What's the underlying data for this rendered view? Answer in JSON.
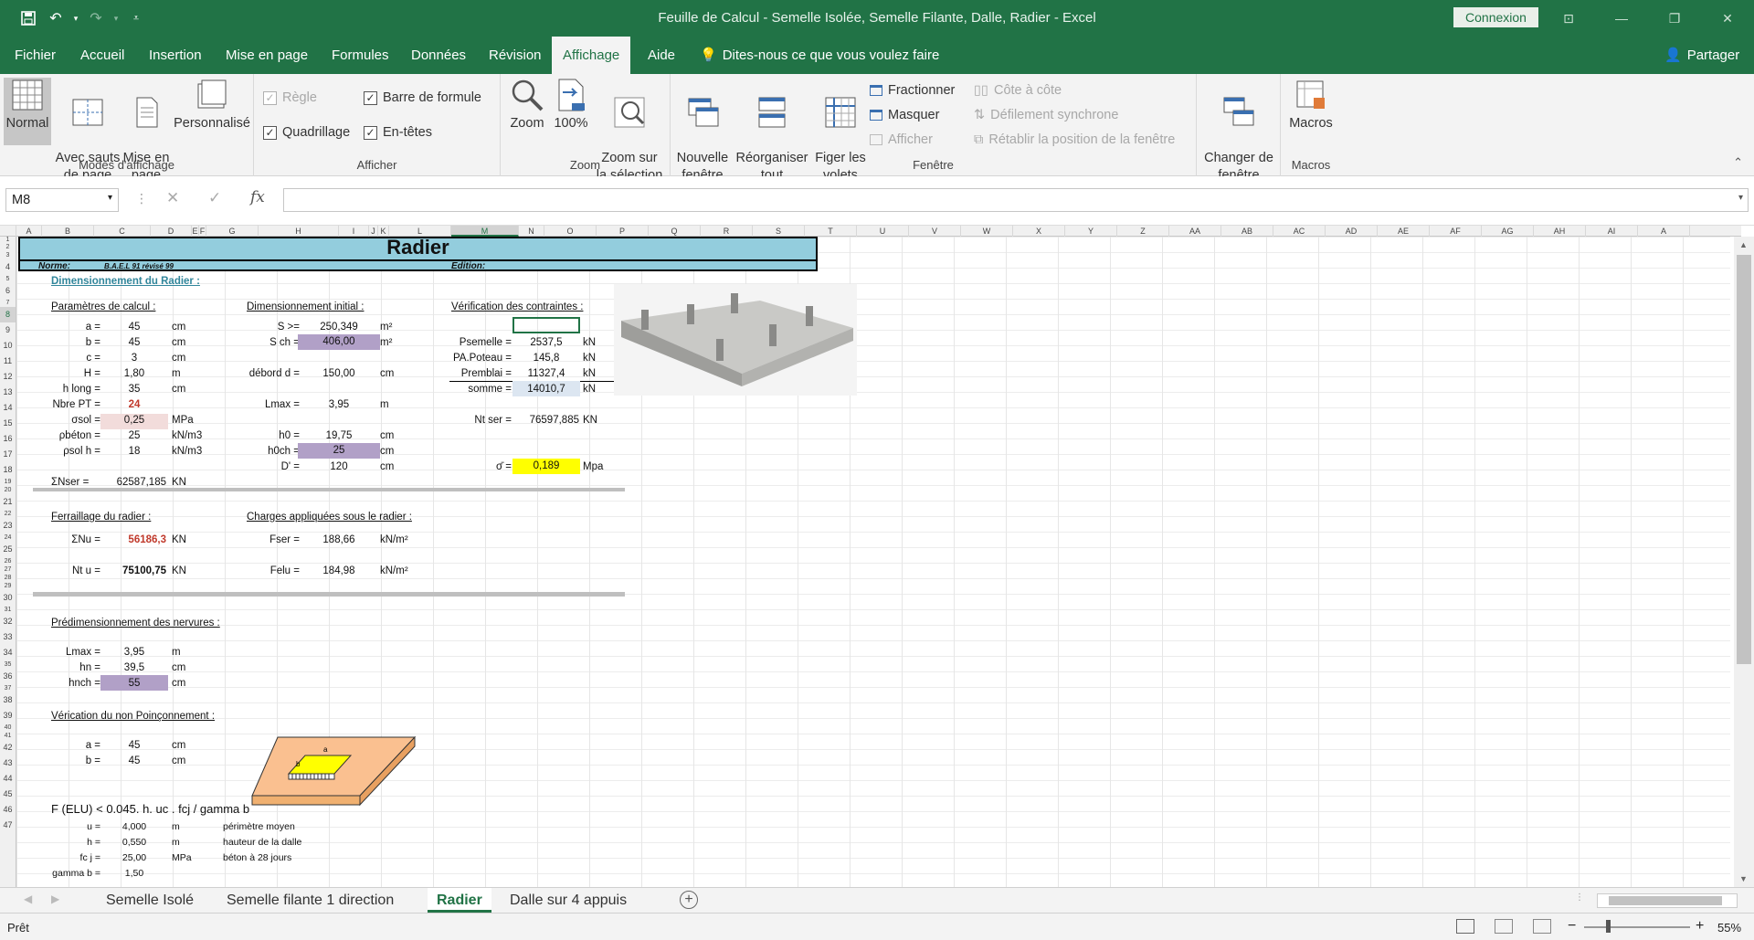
{
  "window": {
    "title": "Feuille de Calcul - Semelle Isolée, Semelle Filante, Dalle, Radier  -  Excel",
    "connexion": "Connexion"
  },
  "menu": {
    "tabs": [
      "Fichier",
      "Accueil",
      "Insertion",
      "Mise en page",
      "Formules",
      "Données",
      "Révision",
      "Affichage",
      "Aide"
    ],
    "tell": "Dites-nous ce que vous voulez faire",
    "share": "Partager"
  },
  "ribbon": {
    "modes": {
      "label": "Modes d'affichage",
      "normal": "Normal",
      "sauts": "Avec sauts\nde page",
      "mise_en_page": "Mise en\npage",
      "perso": "Personnalisé"
    },
    "afficher": {
      "label": "Afficher",
      "regle": "Règle",
      "barre": "Barre de formule",
      "quadrillage": "Quadrillage",
      "entetes": "En-têtes"
    },
    "zoom": {
      "label": "Zoom",
      "zoom": "Zoom",
      "cent": "100%",
      "selection": "Zoom sur\nla sélection"
    },
    "fenetre": {
      "label": "Fenêtre",
      "nouvelle": "Nouvelle\nfenêtre",
      "reorg": "Réorganiser\ntout",
      "figer": "Figer les\nvolets",
      "fractionner": "Fractionner",
      "masquer": "Masquer",
      "afficher": "Afficher",
      "cote": "Côte à côte",
      "defilement": "Défilement synchrone",
      "retablir": "Rétablir la position de la fenêtre",
      "changer": "Changer de\nfenêtre"
    },
    "macros": {
      "label": "Macros",
      "macros": "Macros"
    }
  },
  "formula": {
    "namebox": "M8",
    "value": ""
  },
  "columns": [
    "A",
    "B",
    "C",
    "D",
    "E",
    "F",
    "G",
    "H",
    "I",
    "J",
    "K",
    "L",
    "M",
    "N",
    "O",
    "P",
    "Q",
    "R",
    "S",
    "T",
    "U",
    "V",
    "W",
    "X",
    "Y",
    "Z",
    "AA",
    "AB",
    "AC",
    "AD",
    "AE",
    "AF",
    "AG",
    "AH",
    "AI",
    "A"
  ],
  "rows": [
    "1",
    "2",
    "3",
    "4",
    "5",
    "6",
    "7",
    "8",
    "9",
    "10",
    "11",
    "12",
    "13",
    "14",
    "15",
    "16",
    "17",
    "18",
    "19",
    "20",
    "21",
    "22",
    "23",
    "24",
    "25",
    "26",
    "27",
    "28",
    "29",
    "30",
    "31",
    "32",
    "33",
    "34",
    "35",
    "36",
    "37",
    "38",
    "39",
    "40",
    "41",
    "42",
    "43",
    "44",
    "45",
    "46",
    "47"
  ],
  "sheet": {
    "title": "Radier",
    "norme_label": "Norme:",
    "norme_value": "B.A.E.L 91 révisé 99",
    "edition": "Edition:",
    "dimensionnement": "Dimensionnement du Radier :",
    "params_title": "Paramètres  de calcul :",
    "params": [
      [
        "a =",
        "45",
        "cm"
      ],
      [
        "b =",
        "45",
        "cm"
      ],
      [
        "c =",
        "3",
        "cm"
      ],
      [
        "H =",
        "1,80",
        "m"
      ],
      [
        "h long =",
        "35",
        "cm"
      ],
      [
        "Nbre PT =",
        "24",
        ""
      ],
      [
        "σsol =",
        "0,25",
        "MPa"
      ],
      [
        "ρbéton =",
        "25",
        "kN/m3"
      ],
      [
        "ρsol h =",
        "18",
        "kN/m3"
      ]
    ],
    "nser_label": "ΣNser =",
    "nser_value": "62587,185",
    "nser_unit": "KN",
    "dim_init_title": "Dimensionnement initial :",
    "dim_init": {
      "s_label": "S >=",
      "s_value": "250,349",
      "s_unit": "m²",
      "sch_label": "S ch =",
      "sch_value": "406,00",
      "sch_unit": "m²",
      "debord_label": "débord d =",
      "debord_value": "150,00",
      "debord_unit": "cm",
      "lmax_label": "Lmax =",
      "lmax_value": "3,95",
      "lmax_unit": "m",
      "h0_label": "h0 =",
      "h0_value": "19,75",
      "h0_unit": "cm",
      "h0ch_label": "h0ch =",
      "h0ch_value": "25",
      "h0ch_unit": "cm",
      "d_label": "D' =",
      "d_value": "120",
      "d_unit": "cm"
    },
    "verif_title": "Vérification des contraintes :",
    "verif": [
      [
        "Psemelle =",
        "2537,5",
        "kN"
      ],
      [
        "PA.Poteau =",
        "145,8",
        "kN"
      ],
      [
        "Premblai =",
        "11327,4",
        "kN"
      ],
      [
        "somme =",
        "14010,7",
        "kN"
      ]
    ],
    "ntser": {
      "label": "Nt ser =",
      "value": "76597,885",
      "unit": "KN"
    },
    "sigma": {
      "label": "σ̄ =",
      "value": "0,189",
      "unit": "Mpa"
    },
    "ferr_title": "Ferraillage du radier :",
    "nu": {
      "label": "ΣNu =",
      "value": "56186,3",
      "unit": "KN"
    },
    "ntu": {
      "label": "Nt u =",
      "value": "75100,75",
      "unit": "KN"
    },
    "charges_title": "Charges appliquées sous le radier :",
    "fser": {
      "label": "Fser =",
      "value": "188,66",
      "unit": "kN/m²"
    },
    "felu": {
      "label": "Felu =",
      "value": "184,98",
      "unit": "kN/m²"
    },
    "predim_title": "Prédimensionnement des nervures :",
    "predim": [
      [
        "Lmax =",
        "3,95",
        "m"
      ],
      [
        "hn =",
        "39,5",
        "cm"
      ],
      [
        "hnch =",
        "55",
        "cm"
      ]
    ],
    "poin_title": "Vérication du non Poinçonnement :",
    "poin": [
      [
        "a =",
        "45",
        "cm"
      ],
      [
        "b =",
        "45",
        "cm"
      ]
    ],
    "formula_line": "F (ELU) < 0.045. h. uc . fcj / gamma b",
    "rows_bottom": [
      [
        "u =",
        "4,000",
        "m",
        "périmètre moyen"
      ],
      [
        "h =",
        "0,550",
        "m",
        "hauteur de la dalle"
      ],
      [
        "fc j =",
        "25,00",
        "MPa",
        "béton à 28 jours"
      ],
      [
        "gamma b =",
        "1,50",
        "",
        ""
      ]
    ],
    "diagram_labels": {
      "a": "a",
      "b": "b",
      "h": "h"
    }
  },
  "sheettabs": [
    "Semelle Isolé",
    "Semelle filante 1 direction",
    "Radier",
    "Dalle sur 4 appuis"
  ],
  "status": {
    "ready": "Prêt",
    "zoom": "55%"
  }
}
